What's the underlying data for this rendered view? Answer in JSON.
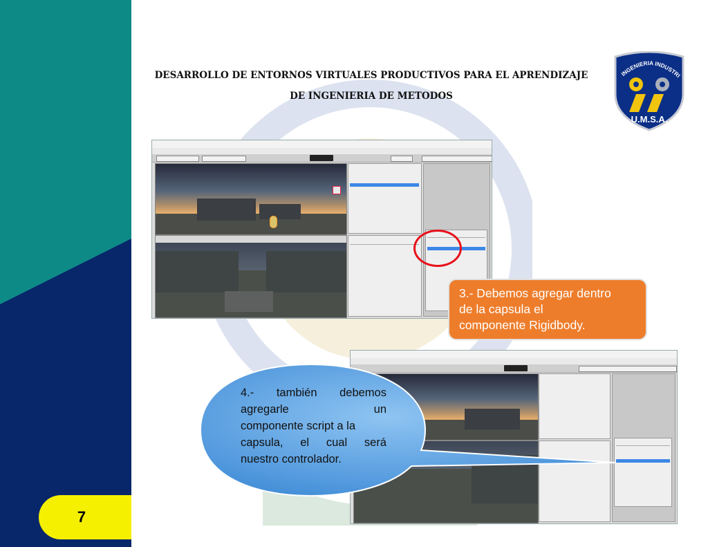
{
  "document": {
    "title_lines": [
      "DESARROLLO DE ENTORNOS VIRTUALES PRODUCTIVOS PARA EL APRENDIZAJE",
      "DE INGENIERIA DE METODOS"
    ],
    "page_number": "7"
  },
  "logo": {
    "arc_text": "INGENIERIA INDUSTRIAL",
    "bottom_text": "U.M.S.A."
  },
  "callouts": {
    "step3_lines": [
      "3.- Debemos agregar dentro",
      "de la capsula el",
      "componente Rigidbody."
    ],
    "step4_lines": [
      [
        "4.-",
        "también",
        "debemos"
      ],
      [
        "agregarle",
        "un"
      ],
      [
        "componente script a la"
      ],
      [
        "capsula,",
        "el",
        "cual",
        "será"
      ],
      [
        "nuestro controlador."
      ]
    ]
  },
  "colors": {
    "teal": "#0e8a86",
    "navy": "#08276b",
    "badge_yellow": "#f5f000",
    "callout_orange": "#ee7d2b",
    "bubble_blue": "#4f9fe0",
    "highlight_red": "#e8101a"
  }
}
